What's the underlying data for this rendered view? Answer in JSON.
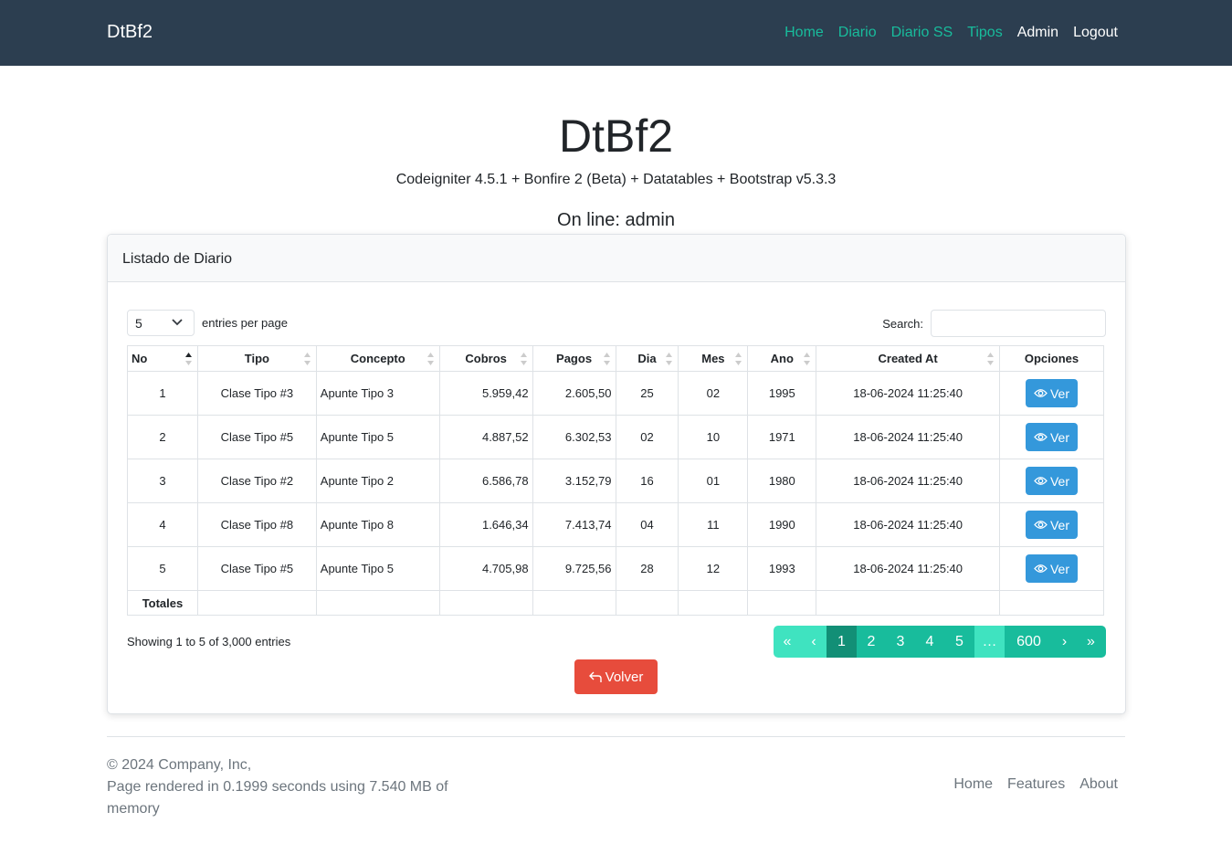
{
  "navbar": {
    "brand": "DtBf2",
    "links": [
      "Home",
      "Diario",
      "Diario SS",
      "Tipos",
      "Admin",
      "Logout"
    ]
  },
  "hero": {
    "title": "DtBf2",
    "subtitle": "Codeigniter 4.5.1 + Bonfire 2 (Beta) + Datatables + Bootstrap v5.3.3",
    "online": "On line: admin"
  },
  "card": {
    "header": "Listado de Diario",
    "entries_value": "5",
    "entries_label": "entries per page",
    "search_label": "Search:",
    "search_value": "",
    "columns": [
      "No",
      "Tipo",
      "Concepto",
      "Cobros",
      "Pagos",
      "Dia",
      "Mes",
      "Ano",
      "Created At",
      "Opciones"
    ],
    "rows": [
      {
        "no": "1",
        "tipo": "Clase Tipo #3",
        "concepto": "Apunte Tipo 3",
        "cobros": "5.959,42",
        "pagos": "2.605,50",
        "dia": "25",
        "mes": "02",
        "ano": "1995",
        "created": "18-06-2024 11:25:40",
        "btn": "Ver"
      },
      {
        "no": "2",
        "tipo": "Clase Tipo #5",
        "concepto": "Apunte Tipo 5",
        "cobros": "4.887,52",
        "pagos": "6.302,53",
        "dia": "02",
        "mes": "10",
        "ano": "1971",
        "created": "18-06-2024 11:25:40",
        "btn": "Ver"
      },
      {
        "no": "3",
        "tipo": "Clase Tipo #2",
        "concepto": "Apunte Tipo 2",
        "cobros": "6.586,78",
        "pagos": "3.152,79",
        "dia": "16",
        "mes": "01",
        "ano": "1980",
        "created": "18-06-2024 11:25:40",
        "btn": "Ver"
      },
      {
        "no": "4",
        "tipo": "Clase Tipo #8",
        "concepto": "Apunte Tipo 8",
        "cobros": "1.646,34",
        "pagos": "7.413,74",
        "dia": "04",
        "mes": "11",
        "ano": "1990",
        "created": "18-06-2024 11:25:40",
        "btn": "Ver"
      },
      {
        "no": "5",
        "tipo": "Clase Tipo #5",
        "concepto": "Apunte Tipo 5",
        "cobros": "4.705,98",
        "pagos": "9.725,56",
        "dia": "28",
        "mes": "12",
        "ano": "1993",
        "created": "18-06-2024 11:25:40",
        "btn": "Ver"
      }
    ],
    "totals_label": "Totales",
    "info": "Showing 1 to 5 of 3,000 entries",
    "pager": [
      "«",
      "‹",
      "1",
      "2",
      "3",
      "4",
      "5",
      "…",
      "600",
      "›",
      "»"
    ],
    "back_label": "Volver"
  },
  "footer": {
    "copyright": "© 2024 Company, Inc,",
    "render": "Page rendered in 0.1999 seconds using 7.540 MB of memory",
    "links": [
      "Home",
      "Features",
      "About"
    ]
  },
  "colors": {
    "navbar": "#2c3e50",
    "accent": "#18bc9c",
    "button_blue": "#3498db",
    "button_red": "#e74c3c"
  }
}
